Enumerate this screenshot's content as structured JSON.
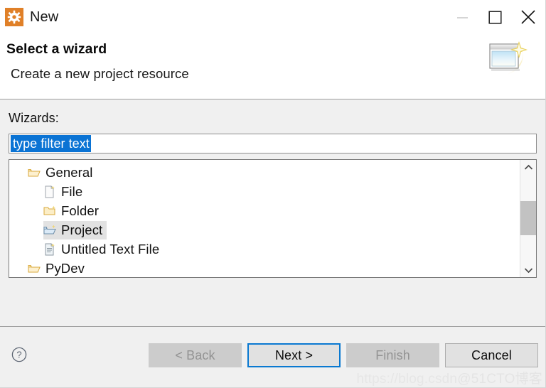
{
  "window": {
    "title": "New",
    "app_icon": "gear-icon",
    "accent_color": "#e08028",
    "controls": {
      "minimize": "minimize-icon",
      "maximize": "maximize-icon",
      "close": "close-icon"
    }
  },
  "header": {
    "title": "Select a wizard",
    "subtitle": "Create a new project resource",
    "banner_icon": "new-wizard-window-sparkle-icon"
  },
  "body": {
    "wizards_label": "Wizards:",
    "filter": {
      "value": "type filter text",
      "placeholder": "type filter text",
      "selected": true,
      "selection_color": "#0a73d4"
    },
    "tree": {
      "items": [
        {
          "label": "General",
          "icon": "open-folder-icon",
          "depth": 1,
          "selected": false,
          "expanded": true
        },
        {
          "label": "File",
          "icon": "new-file-icon",
          "depth": 2,
          "selected": false
        },
        {
          "label": "Folder",
          "icon": "new-folder-icon",
          "depth": 2,
          "selected": false
        },
        {
          "label": "Project",
          "icon": "new-project-icon",
          "depth": 2,
          "selected": true
        },
        {
          "label": "Untitled Text File",
          "icon": "new-text-file-icon",
          "depth": 2,
          "selected": false
        },
        {
          "label": "PyDev",
          "icon": "open-folder-icon",
          "depth": 1,
          "selected": false,
          "expanded": false
        }
      ],
      "selection_color": "#e2e2e2",
      "scrollbar": {
        "up_arrow": "chevron-up-icon",
        "down_arrow": "chevron-down-icon",
        "thumb_color": "#c2c2c2"
      }
    }
  },
  "footer": {
    "help_icon": "help-question-icon",
    "buttons": [
      {
        "label": "< Back",
        "state": "disabled"
      },
      {
        "label": "Next >",
        "state": "default"
      },
      {
        "label": "Finish",
        "state": "disabled"
      },
      {
        "label": "Cancel",
        "state": "normal"
      }
    ],
    "focus_color": "#0a79d1"
  },
  "watermark": {
    "url": "https://blog.csdn",
    "handle": "@51CTO博客"
  }
}
